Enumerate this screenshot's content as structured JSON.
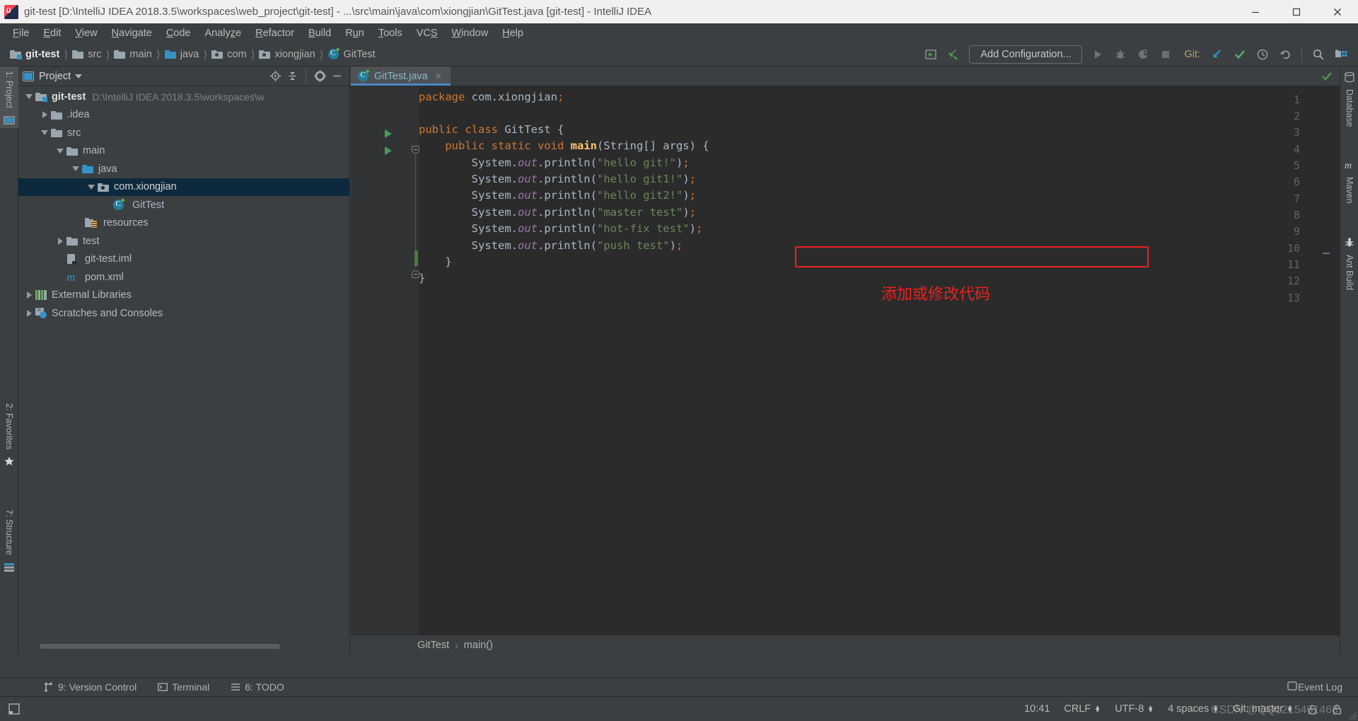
{
  "window": {
    "title": "git-test [D:\\IntelliJ IDEA 2018.3.5\\workspaces\\web_project\\git-test] - ...\\src\\main\\java\\com\\xiongjian\\GitTest.java [git-test] - IntelliJ IDEA",
    "app_icon": "intellij-idea-icon",
    "minimize_label": "Minimize",
    "maximize_label": "Maximize",
    "close_label": "Close"
  },
  "menubar": {
    "items": [
      {
        "label": "File",
        "mnemonic": "F"
      },
      {
        "label": "Edit",
        "mnemonic": "E"
      },
      {
        "label": "View",
        "mnemonic": "V"
      },
      {
        "label": "Navigate",
        "mnemonic": "N"
      },
      {
        "label": "Code",
        "mnemonic": "C"
      },
      {
        "label": "Analyze",
        "mnemonic": "z"
      },
      {
        "label": "Refactor",
        "mnemonic": "R"
      },
      {
        "label": "Build",
        "mnemonic": "B"
      },
      {
        "label": "Run",
        "mnemonic": "u"
      },
      {
        "label": "Tools",
        "mnemonic": "T"
      },
      {
        "label": "VCS",
        "mnemonic": "S"
      },
      {
        "label": "Window",
        "mnemonic": "W"
      },
      {
        "label": "Help",
        "mnemonic": "H"
      }
    ]
  },
  "navbar": {
    "breadcrumbs": [
      {
        "label": "git-test",
        "icon": "module-folder-icon"
      },
      {
        "label": "src",
        "icon": "folder-icon"
      },
      {
        "label": "main",
        "icon": "folder-icon"
      },
      {
        "label": "java",
        "icon": "source-root-folder-icon"
      },
      {
        "label": "com",
        "icon": "package-icon"
      },
      {
        "label": "xiongjian",
        "icon": "package-icon"
      },
      {
        "label": "GitTest",
        "icon": "java-class-icon"
      }
    ],
    "add_configuration": "Add Configuration...",
    "git_label": "Git:",
    "toolbar_icons": [
      "build-project-icon",
      "build-hammer-icon",
      "run-icon",
      "debug-icon",
      "run-with-coverage-icon",
      "stop-icon",
      "update-project-icon",
      "commit-icon",
      "history-icon",
      "revert-icon",
      "search-everywhere-icon",
      "project-structure-icon"
    ]
  },
  "left_strip": {
    "tabs": [
      {
        "label": "1: Project",
        "icon": "project-icon",
        "active": true
      },
      {
        "label": "2: Favorites",
        "icon": "favorites-star-icon",
        "active": false
      },
      {
        "label": "7: Structure",
        "icon": "structure-icon",
        "active": false
      }
    ]
  },
  "right_strip": {
    "tabs": [
      {
        "label": "Database",
        "icon": "database-icon"
      },
      {
        "label": "Maven",
        "icon": "maven-m-icon"
      },
      {
        "label": "Ant Build",
        "icon": "ant-icon"
      }
    ]
  },
  "project_panel": {
    "title": "Project",
    "header_icons": [
      "locate-icon",
      "collapse-all-icon",
      "settings-gear-icon",
      "hide-icon"
    ],
    "tree": [
      {
        "label": "git-test",
        "secondary": "D:\\IntelliJ IDEA 2018.3.5\\workspaces\\w",
        "indent": 0,
        "arrow": "down",
        "icon": "module-folder-icon",
        "bold": true,
        "selected": false
      },
      {
        "label": ".idea",
        "secondary": "",
        "indent": 1,
        "arrow": "right",
        "icon": "folder-icon",
        "bold": false,
        "selected": false
      },
      {
        "label": "src",
        "secondary": "",
        "indent": 1,
        "arrow": "down",
        "icon": "folder-icon",
        "bold": false,
        "selected": false
      },
      {
        "label": "main",
        "secondary": "",
        "indent": 2,
        "arrow": "down",
        "icon": "folder-icon",
        "bold": false,
        "selected": false
      },
      {
        "label": "java",
        "secondary": "",
        "indent": 3,
        "arrow": "down",
        "icon": "source-root-folder-icon",
        "bold": false,
        "selected": false
      },
      {
        "label": "com.xiongjian",
        "secondary": "",
        "indent": 4,
        "arrow": "down",
        "icon": "package-icon",
        "bold": false,
        "selected": true
      },
      {
        "label": "GitTest",
        "secondary": "",
        "indent": 5,
        "arrow": "none",
        "icon": "java-class-icon",
        "bold": false,
        "selected": false
      },
      {
        "label": "resources",
        "secondary": "",
        "indent": 3,
        "arrow": "none",
        "icon": "resources-folder-icon",
        "bold": false,
        "selected": false
      },
      {
        "label": "test",
        "secondary": "",
        "indent": 2,
        "arrow": "right",
        "icon": "folder-icon",
        "bold": false,
        "selected": false
      },
      {
        "label": "git-test.iml",
        "secondary": "",
        "indent": 2,
        "arrow": "none",
        "icon": "iml-file-icon",
        "bold": false,
        "selected": false
      },
      {
        "label": "pom.xml",
        "secondary": "",
        "indent": 2,
        "arrow": "none",
        "icon": "maven-pom-icon",
        "bold": false,
        "selected": false
      },
      {
        "label": "External Libraries",
        "secondary": "",
        "indent": 0,
        "arrow": "right",
        "icon": "libraries-icon",
        "bold": false,
        "selected": false
      },
      {
        "label": "Scratches and Consoles",
        "secondary": "",
        "indent": 0,
        "arrow": "right",
        "icon": "scratches-icon",
        "bold": false,
        "selected": false
      }
    ]
  },
  "editor": {
    "tab": {
      "label": "GitTest.java",
      "icon": "java-class-icon",
      "close": "×"
    },
    "lines": [
      {
        "n": 1,
        "text": "package com.xiongjian;",
        "runmarker": false
      },
      {
        "n": 2,
        "text": "",
        "runmarker": false
      },
      {
        "n": 3,
        "text": "public class GitTest {",
        "runmarker": true
      },
      {
        "n": 4,
        "text": "    public static void main(String[] args) {",
        "runmarker": true
      },
      {
        "n": 5,
        "text": "        System.out.println(\"hello git!\");",
        "runmarker": false
      },
      {
        "n": 6,
        "text": "        System.out.println(\"hello git1!\");",
        "runmarker": false
      },
      {
        "n": 7,
        "text": "        System.out.println(\"hello git2!\");",
        "runmarker": false
      },
      {
        "n": 8,
        "text": "        System.out.println(\"master test\");",
        "runmarker": false
      },
      {
        "n": 9,
        "text": "        System.out.println(\"hot-fix test\");",
        "runmarker": false
      },
      {
        "n": 10,
        "text": "        System.out.println(\"push test\");",
        "runmarker": false
      },
      {
        "n": 11,
        "text": "    }",
        "runmarker": false
      },
      {
        "n": 12,
        "text": "}",
        "runmarker": false
      },
      {
        "n": 13,
        "text": "",
        "runmarker": false
      }
    ],
    "annotation": "添加或修改代码",
    "annotation_color": "#ee2020",
    "highlight_line": 10,
    "bottom_breadcrumb": [
      "GitTest",
      "main()"
    ]
  },
  "bottom_toolbar": {
    "buttons": [
      {
        "label": "9: Version Control",
        "mnemonic": "9",
        "icon": "version-control-icon"
      },
      {
        "label": "Terminal",
        "mnemonic": "",
        "icon": "terminal-icon"
      },
      {
        "label": "6: TODO",
        "mnemonic": "6",
        "icon": "todo-icon"
      }
    ],
    "event_log": "Event Log",
    "event_log_icon": "event-log-icon"
  },
  "statusbar": {
    "toggle_icon": "toggle-toolbar-icon",
    "time": "10:41",
    "line_separator": "CRLF",
    "encoding": "UTF-8",
    "indent": "4 spaces",
    "git_branch": "Git: master",
    "lock_icon": "unlock-icon",
    "inspection_icon": "inspections-icon"
  },
  "watermark": "CSDN @QQ1215461468"
}
